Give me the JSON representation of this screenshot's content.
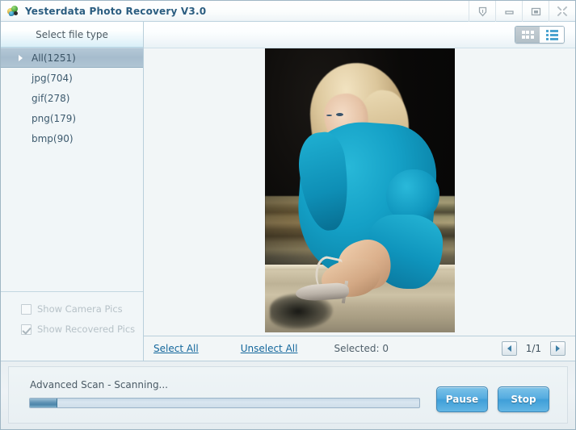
{
  "window": {
    "title": "Yesterdata Photo Recovery V3.0",
    "app_icon": "app-icon",
    "controls": [
      {
        "name": "shield-icon",
        "label": ""
      },
      {
        "name": "minimize-icon",
        "label": ""
      },
      {
        "name": "maximize-icon",
        "label": ""
      },
      {
        "name": "close-icon",
        "label": ""
      }
    ]
  },
  "sidebar": {
    "header": "Select file type",
    "items": [
      {
        "label": "All(1251)",
        "selected": true
      },
      {
        "label": "jpg(704)",
        "selected": false
      },
      {
        "label": "gif(278)",
        "selected": false
      },
      {
        "label": "png(179)",
        "selected": false
      },
      {
        "label": "bmp(90)",
        "selected": false
      }
    ],
    "checkboxes": [
      {
        "label": "Show Camera Pics",
        "checked": false,
        "disabled": true
      },
      {
        "label": "Show Recovered Pics",
        "checked": true,
        "disabled": true
      }
    ]
  },
  "toolbar": {
    "view_grid": "grid-view-icon",
    "view_list": "list-view-icon",
    "active_view": "grid"
  },
  "preview": {
    "description": "Recovered photo thumbnail: blonde woman in teal sweater crouching on stone steps",
    "count": 1
  },
  "selection_bar": {
    "select_all": "Select All",
    "unselect_all": "Unselect All",
    "selected_count": "Selected: 0",
    "prev": "‹",
    "next": "›",
    "page_label": "1/1"
  },
  "footer": {
    "status": "Advanced Scan - Scanning...",
    "progress_percent": 7,
    "pause_label": "Pause",
    "stop_label": "Stop"
  },
  "colors": {
    "accent": "#3f9fd8",
    "link": "#14679c",
    "title": "#2b5d80",
    "sidebar_selected": "#a6bccd"
  }
}
